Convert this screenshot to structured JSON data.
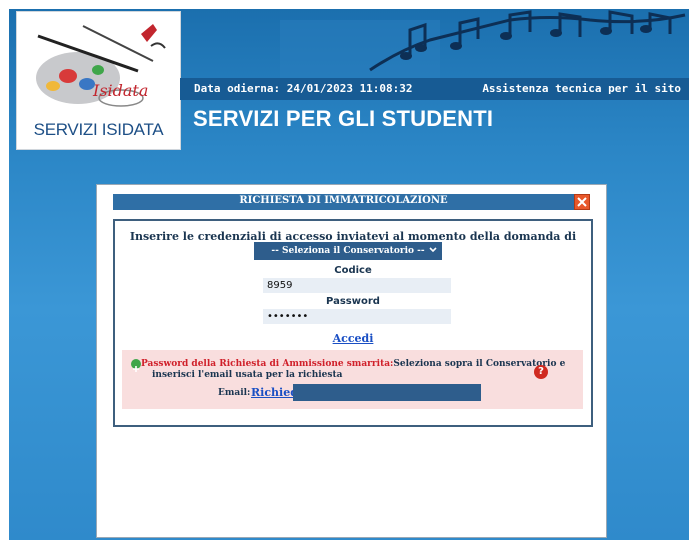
{
  "header": {
    "logo_caption": "SERVIZI ISIDATA",
    "logo_wordmark": "Isidata",
    "date_label": "Data odierna: 24/01/2023 11:08:32",
    "assistance_link": "Assistenza tecnica per il sito",
    "page_title": "SERVIZI PER GLI STUDENTI"
  },
  "dialog": {
    "title": "RICHIESTA DI IMMATRICOLAZIONE",
    "instruction": "Inserire le credenziali di accesso inviatevi al momento della domanda di ammissione:",
    "conservatory_select": "-- Seleziona il Conservatorio --",
    "code_label": "Codice",
    "code_value": "8959",
    "password_label": "Password",
    "password_value": "•••••••",
    "login_link": "Accedi",
    "recovery": {
      "title": "Password della Richiesta di Ammissione smarrita:",
      "text_line1": "Seleziona sopra il Conservatorio e",
      "text_line2": "inserisci l'email usata per la richiesta",
      "email_label": "Email:",
      "request_link": "Richiedi",
      "email_value": ""
    }
  },
  "colors": {
    "background_blue": "#2b86c6",
    "header_band": "#175b94",
    "dialog_titlebar": "#2f6fa6",
    "select_bg": "#2e5d8c",
    "link_blue": "#1a4fc4",
    "recovery_bg": "#f9dede",
    "error_red": "#d0202a"
  },
  "icons": {
    "close": "close-icon",
    "plus": "plus-circle-icon",
    "help": "question-icon",
    "dropdown": "chevron-down-icon"
  }
}
